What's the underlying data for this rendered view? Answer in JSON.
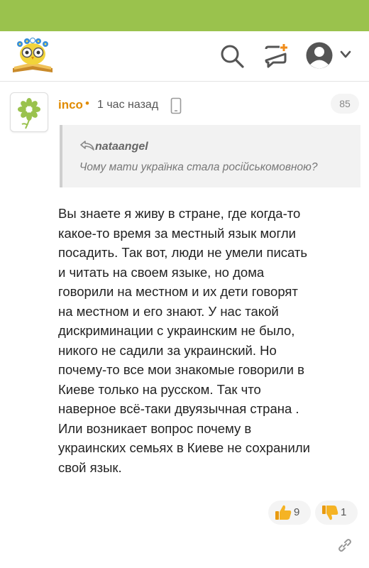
{
  "colors": {
    "topbar": "#9ac24d",
    "username": "#e08b00",
    "accent_icon": "#f08c1a"
  },
  "header": {
    "logo": "owl-logo",
    "icons": [
      "search-icon",
      "compose-icon",
      "avatar-icon",
      "chevron-down-icon"
    ]
  },
  "comment": {
    "username": "inco",
    "separator": "•",
    "time": "1 час назад",
    "device_icon": "mobile-phone-icon",
    "counter": "85",
    "quote": {
      "author": "nataangel",
      "text": "Чому мати українка стала російськомовною?"
    },
    "text": "Вы знаете я живу в стране, где когда-то\nкакое-то время за местный язык могли\nпосадить. Так вот, люди не умели писать\nи читать на своем языке, но дома\nговорили на местном и их дети говорят\nна местном и его знают. У нас такой\nдискриминации с украинским не было,\nникого не садили за украинский. Но\nпочему-то все мои знакомые говорили в\nКиеве только на русском. Так что\nнаверное всё-таки двуязычная страна .\nИли возникает вопрос почему в\nукраинских семьях в Киеве не сохранили\nсвой язык.",
    "likes": "9",
    "dislikes": "1"
  }
}
